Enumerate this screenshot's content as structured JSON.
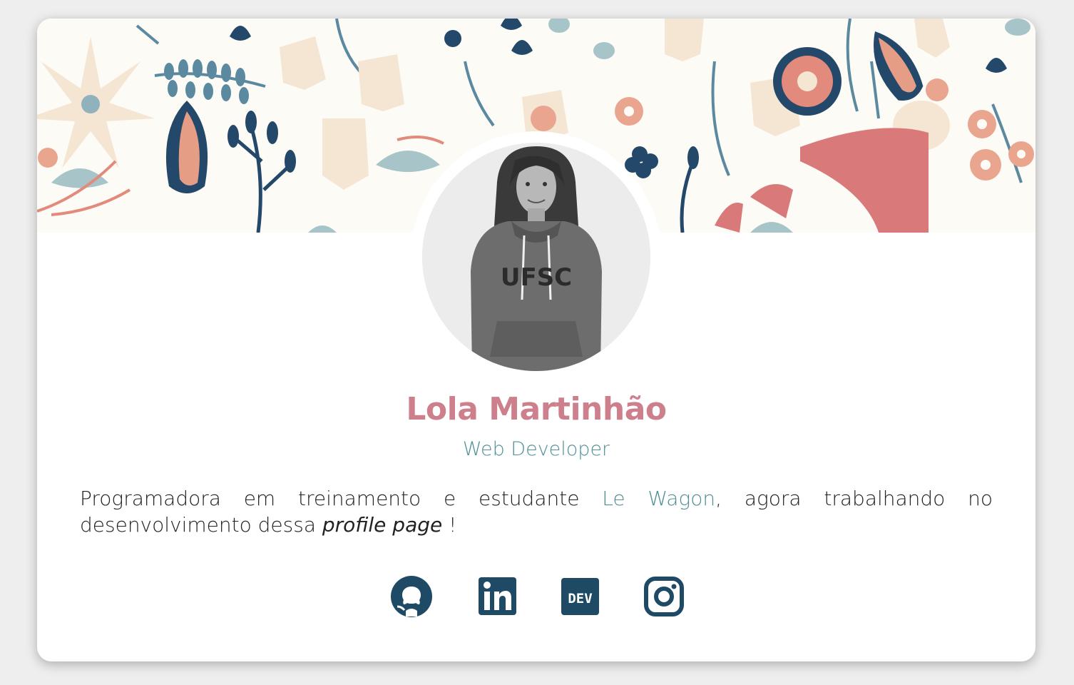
{
  "profile": {
    "name": "Lola Martinhão",
    "role": "Web Developer",
    "bio": {
      "part1": "Programadora em treinamento e estudante ",
      "link_text": "Le Wagon",
      "part2": ", agora trabalhando no desenvolvimento dessa ",
      "italic": "profile page",
      "part3": " !"
    }
  },
  "socials": [
    {
      "icon": "github-icon"
    },
    {
      "icon": "linkedin-icon"
    },
    {
      "icon": "dev-icon",
      "label": "DEV"
    },
    {
      "icon": "instagram-icon"
    }
  ],
  "colors": {
    "name": "#cd7f8b",
    "accent": "#4f8f98",
    "icons": "#1f4a66",
    "text": "#222222"
  }
}
